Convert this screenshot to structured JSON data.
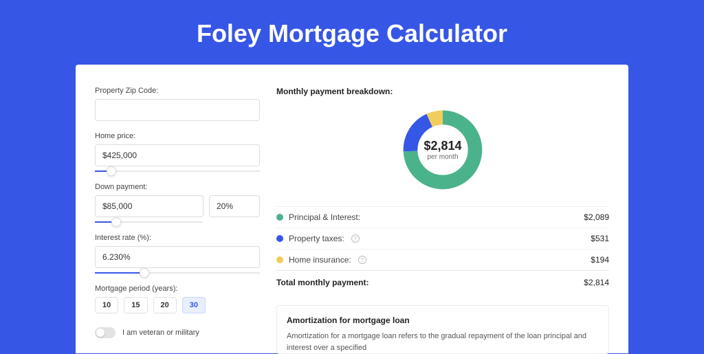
{
  "title": "Foley Mortgage Calculator",
  "form": {
    "zip_label": "Property Zip Code:",
    "zip_value": "",
    "home_price_label": "Home price:",
    "home_price_value": "$425,000",
    "down_payment_label": "Down payment:",
    "down_payment_value": "$85,000",
    "down_payment_pct": "20%",
    "interest_label": "Interest rate (%):",
    "interest_value": "6.230%",
    "period_label": "Mortgage period (years):",
    "periods": [
      "10",
      "15",
      "20",
      "30"
    ],
    "period_active_index": 3,
    "veteran_label": "I am veteran or military"
  },
  "breakdown": {
    "title": "Monthly payment breakdown:",
    "center_value": "$2,814",
    "center_sub": "per month",
    "rows": [
      {
        "label": "Principal & Interest:",
        "value": "$2,089",
        "color": "#4bb38b",
        "help": false
      },
      {
        "label": "Property taxes:",
        "value": "$531",
        "color": "#3656e6",
        "help": true
      },
      {
        "label": "Home insurance:",
        "value": "$194",
        "color": "#f2cd5c",
        "help": true
      }
    ],
    "total_label": "Total monthly payment:",
    "total_value": "$2,814"
  },
  "amort": {
    "title": "Amortization for mortgage loan",
    "text": "Amortization for a mortgage loan refers to the gradual repayment of the loan principal and interest over a specified"
  },
  "sliders": {
    "home_price_pct": 10,
    "down_payment_pct": 20,
    "interest_pct": 30
  },
  "colors": {
    "accent": "#3656e6",
    "green": "#4bb38b",
    "yellow": "#f2cd5c",
    "blue": "#3656e6"
  },
  "chart_data": {
    "type": "pie",
    "title": "Monthly payment breakdown",
    "categories": [
      "Principal & Interest",
      "Property taxes",
      "Home insurance"
    ],
    "values": [
      2089,
      531,
      194
    ],
    "total": 2814,
    "series_colors": [
      "#4bb38b",
      "#3656e6",
      "#f2cd5c"
    ]
  }
}
